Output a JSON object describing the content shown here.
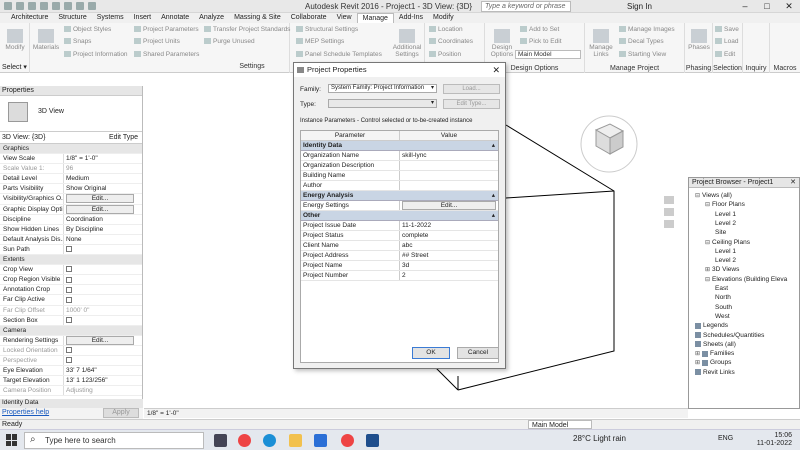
{
  "app": {
    "title": "Autodesk Revit 2016 -   Project1 - 3D View: {3D}",
    "search_placeholder": "Type a keyword or phrase",
    "sign_in": "Sign In"
  },
  "menu_tabs": [
    "Architecture",
    "Structure",
    "Systems",
    "Insert",
    "Annotate",
    "Analyze",
    "Massing & Site",
    "Collaborate",
    "View",
    "Manage",
    "Add-Ins",
    "Modify"
  ],
  "active_tab": "Manage",
  "ribbon": {
    "modify": "Modify",
    "materials": "Materials",
    "object_styles": "Object Styles",
    "snaps": "Snaps",
    "project_information": "Project Information",
    "project_parameters": "Project Parameters",
    "project_units": "Project Units",
    "shared_parameters": "Shared Parameters",
    "transfer_standards": "Transfer Project Standards",
    "purge_unused": "Purge Unused",
    "structural_settings": "Structural Settings",
    "mep_settings": "MEP Settings",
    "panel_schedule_templates": "Panel Schedule Templates",
    "additional_settings": "Additional Settings",
    "location": "Location",
    "coordinates": "Coordinates",
    "position": "Position",
    "design_options": "Design Options",
    "add_to_set": "Add to Set",
    "pick_to_edit": "Pick to Edit",
    "main_model": "Main Model",
    "manage_links": "Manage Links",
    "manage_images": "Manage Images",
    "decal_types": "Decal Types",
    "starting_view": "Starting View",
    "phases": "Phases",
    "save": "Save",
    "load": "Load",
    "edit": "Edit",
    "groups": {
      "select": "Select ▾",
      "settings": "Settings",
      "design_options": "Design Options",
      "manage_project": "Manage Project",
      "phasing": "Phasing",
      "selection": "Selection",
      "inquiry": "Inquiry",
      "macros": "Macros"
    }
  },
  "properties": {
    "header": "Properties",
    "type_name": "3D View",
    "selector": "3D View: {3D}",
    "edit_type": "Edit Type",
    "rows": [
      {
        "k": "Graphics",
        "sec": true
      },
      {
        "k": "View Scale",
        "v": "1/8\" = 1'-0\""
      },
      {
        "k": "Scale Value    1:",
        "v": "96",
        "grey": true
      },
      {
        "k": "Detail Level",
        "v": "Medium"
      },
      {
        "k": "Parts Visibility",
        "v": "Show Original"
      },
      {
        "k": "Visibility/Graphics O...",
        "btn": "Edit..."
      },
      {
        "k": "Graphic Display Opti...",
        "btn": "Edit..."
      },
      {
        "k": "Discipline",
        "v": "Coordination"
      },
      {
        "k": "Show Hidden Lines",
        "v": "By Discipline"
      },
      {
        "k": "Default Analysis Dis...",
        "v": "None"
      },
      {
        "k": "Sun Path",
        "cb": true
      },
      {
        "k": "Extents",
        "sec": true
      },
      {
        "k": "Crop View",
        "cb": true
      },
      {
        "k": "Crop Region Visible",
        "cb": true
      },
      {
        "k": "Annotation Crop",
        "cb": true
      },
      {
        "k": "Far Clip Active",
        "cb": true
      },
      {
        "k": "Far Clip Offset",
        "v": "1000'  0\"",
        "grey": true
      },
      {
        "k": "Section Box",
        "cb": true
      },
      {
        "k": "Camera",
        "sec": true
      },
      {
        "k": "Rendering Settings",
        "btn": "Edit..."
      },
      {
        "k": "Locked Orientation",
        "cb": true,
        "grey": true
      },
      {
        "k": "Perspective",
        "cb": true,
        "grey": true
      },
      {
        "k": "Eye Elevation",
        "v": "33'  7 1/64\""
      },
      {
        "k": "Target Elevation",
        "v": "13'  1 123/256\""
      },
      {
        "k": "Camera Position",
        "v": "Adjusting",
        "grey": true
      }
    ],
    "help_link": "Properties help",
    "apply": "Apply",
    "identity_data": "Identity Data"
  },
  "browser": {
    "header": "Project Browser - Project1",
    "items": [
      {
        "t": "Views (all)",
        "lvl": 0,
        "tg": "⊟"
      },
      {
        "t": "Floor Plans",
        "lvl": 1,
        "tg": "⊟"
      },
      {
        "t": "Level 1",
        "lvl": 2
      },
      {
        "t": "Level 2",
        "lvl": 2
      },
      {
        "t": "Site",
        "lvl": 2
      },
      {
        "t": "Ceiling Plans",
        "lvl": 1,
        "tg": "⊟"
      },
      {
        "t": "Level 1",
        "lvl": 2
      },
      {
        "t": "Level 2",
        "lvl": 2
      },
      {
        "t": "3D Views",
        "lvl": 1,
        "tg": "⊞"
      },
      {
        "t": "Elevations (Building Eleva",
        "lvl": 1,
        "tg": "⊟"
      },
      {
        "t": "East",
        "lvl": 2
      },
      {
        "t": "North",
        "lvl": 2
      },
      {
        "t": "South",
        "lvl": 2
      },
      {
        "t": "West",
        "lvl": 2
      },
      {
        "t": "Legends",
        "lvl": 0,
        "ico": true
      },
      {
        "t": "Schedules/Quantities",
        "lvl": 0,
        "ico": true
      },
      {
        "t": "Sheets (all)",
        "lvl": 0,
        "ico": true
      },
      {
        "t": "Families",
        "lvl": 0,
        "tg": "⊞",
        "ico": true
      },
      {
        "t": "Groups",
        "lvl": 0,
        "tg": "⊞",
        "ico": true
      },
      {
        "t": "Revit Links",
        "lvl": 0,
        "ico": true
      }
    ]
  },
  "dialog": {
    "title": "Project Properties",
    "family_label": "Family:",
    "family_value": "System Family: Project Information",
    "type_label": "Type:",
    "load_btn": "Load...",
    "edit_type_btn": "Edit Type...",
    "instance_note": "Instance Parameters - Control selected or to-be-created instance",
    "col_parameter": "Parameter",
    "col_value": "Value",
    "sections": [
      {
        "name": "Identity Data",
        "rows": [
          {
            "k": "Organization Name",
            "v": "skill-lync"
          },
          {
            "k": "Organization Description",
            "v": ""
          },
          {
            "k": "Building Name",
            "v": ""
          },
          {
            "k": "Author",
            "v": ""
          }
        ]
      },
      {
        "name": "Energy Analysis",
        "rows": [
          {
            "k": "Energy Settings",
            "btn": "Edit..."
          }
        ]
      },
      {
        "name": "Other",
        "rows": [
          {
            "k": "Project Issue Date",
            "v": "11-1-2022"
          },
          {
            "k": "Project Status",
            "v": "complete"
          },
          {
            "k": "Client Name",
            "v": "abc"
          },
          {
            "k": "Project Address",
            "v": "## Street"
          },
          {
            "k": "Project Name",
            "v": "3d"
          },
          {
            "k": "Project Number",
            "v": "2"
          }
        ]
      }
    ],
    "ok": "OK",
    "cancel": "Cancel"
  },
  "viewbar": {
    "scale": "1/8\" = 1'-0\""
  },
  "status": {
    "text": "Ready",
    "model": "Main Model"
  },
  "taskbar": {
    "search": "Type here to search",
    "weather": "28°C  Light rain",
    "lang": "ENG",
    "time": "15:06",
    "date": "11-01-2022"
  }
}
